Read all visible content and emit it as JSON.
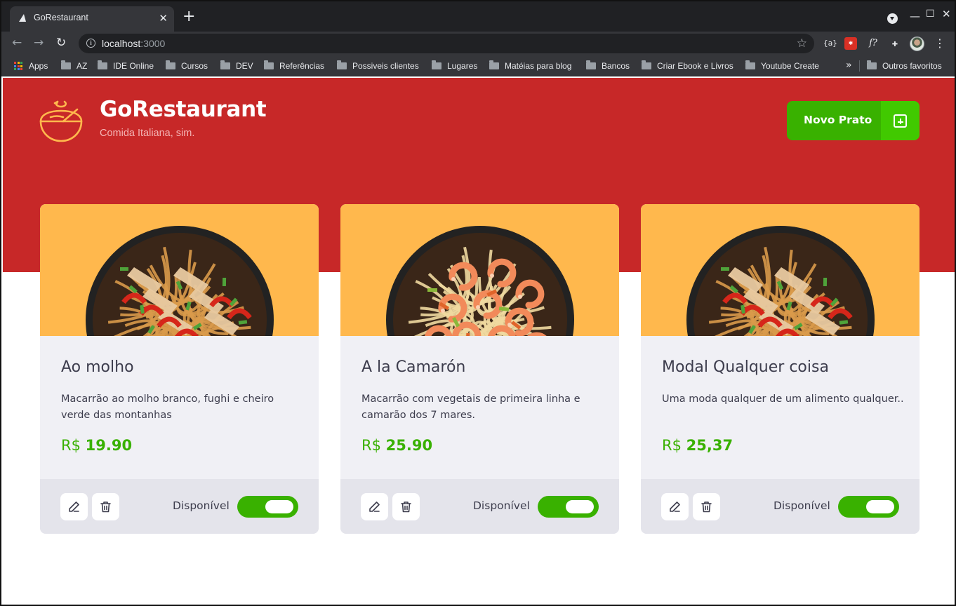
{
  "browser": {
    "tab_title": "GoRestaurant",
    "tab_close": "✕",
    "new_tab": "+",
    "url_host": "localhost",
    "url_port": ":3000",
    "bookmarks": [
      "Apps",
      "AZ",
      "IDE Online",
      "Cursos",
      "DEV",
      "Referências",
      "Possiveis clientes",
      "Lugares",
      "Matéias para blog",
      "Bancos",
      "Criar Ebook e Livros",
      "Youtube Create"
    ],
    "bookmarks_more": "»",
    "other_bookmarks": "Outros favoritos",
    "extensions": [
      "{a}",
      "f?"
    ]
  },
  "header": {
    "brand": "GoRestaurant",
    "subtitle": "Comida Italiana, sim.",
    "new_dish_label": "Novo Prato",
    "colors": {
      "hero": "#c72828",
      "accent": "#39b100",
      "accent_light": "#41c900",
      "logo": "#ffb84d"
    }
  },
  "foods": [
    {
      "name": "Ao molho",
      "description": "Macarrão ao molho branco, fughi e cheiro verde das montanhas",
      "currency": "R$ ",
      "price": "19.90",
      "available_label": "Disponível",
      "available": true,
      "image": "noodles-chicken"
    },
    {
      "name": "A la Camarón",
      "description": "Macarrão com vegetais de primeira linha e camarão dos 7 mares.",
      "currency": "R$ ",
      "price": "25.90",
      "available_label": "Disponível",
      "available": true,
      "image": "noodles-shrimp"
    },
    {
      "name": "Modal Qualquer coisa",
      "description": "Uma moda qualquer de um alimento qualquer..",
      "currency": "R$ ",
      "price": "25,37",
      "available_label": "Disponível",
      "available": true,
      "image": "noodles-chicken"
    }
  ]
}
